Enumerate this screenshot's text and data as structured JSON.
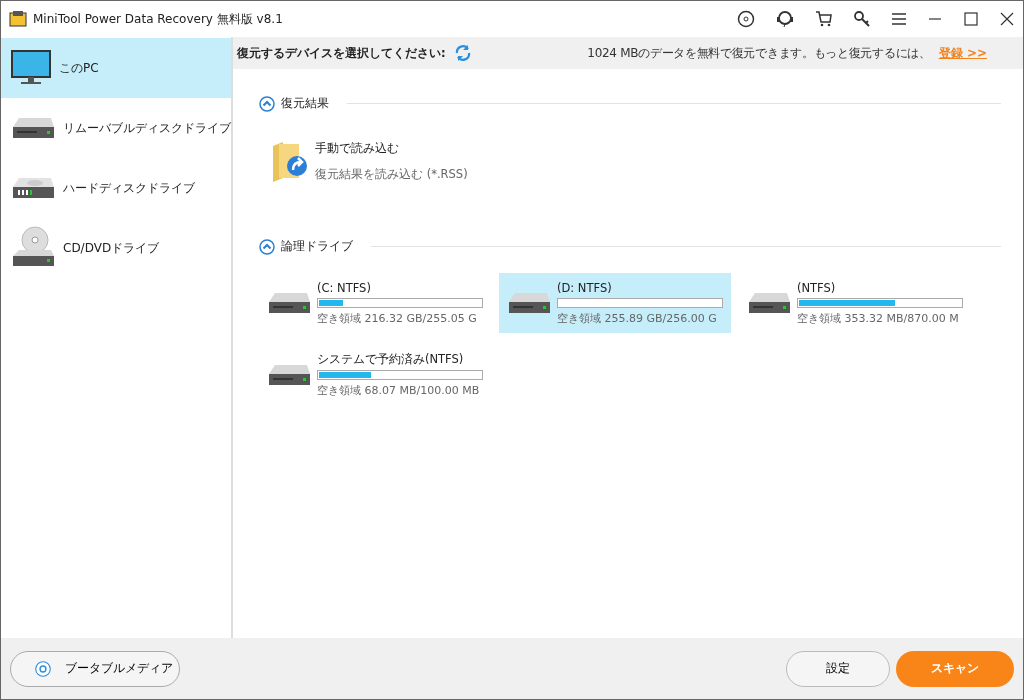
{
  "window": {
    "title": "MiniTool Power Data Recovery 無料版 v8.1"
  },
  "sidebar": {
    "items": [
      {
        "kind": "pc",
        "label": "このPC",
        "selected": true
      },
      {
        "kind": "removable",
        "label": "リムーバブルディスクドライブ",
        "selected": false
      },
      {
        "kind": "hdd",
        "label": "ハードディスクドライブ",
        "selected": false
      },
      {
        "kind": "cd",
        "label": "CD/DVDドライブ",
        "selected": false
      }
    ]
  },
  "header": {
    "prompt": "復元するデバイスを選択してください:",
    "notice": "1024 MBのデータを無料で復元できます。もっと復元するには、",
    "link": "登録 >>"
  },
  "sections": [
    {
      "title": "復元結果",
      "expanded": true,
      "load": {
        "title": "手動で読み込む",
        "subtitle": "復元結果を読み込む (*.RSS)"
      }
    },
    {
      "title": "論理ドライブ",
      "expanded": true,
      "drives": [
        {
          "name": "(C: NTFS)",
          "level": 0.15,
          "free": "空き領域 216.32 GB/255.05 G",
          "selected": false
        },
        {
          "name": "(D: NTFS)",
          "free": "空き領域 255.89 GB/256.00 G",
          "selected": true
        },
        {
          "name": "(NTFS)",
          "level": 0.59,
          "free": "空き領域 353.32 MB/870.00 M",
          "selected": false
        },
        {
          "name": "システムで予約済み(NTFS)",
          "level": 0.32,
          "free": "空き領域 68.07 MB/100.00 MB",
          "selected": false
        }
      ]
    }
  ],
  "footer": {
    "bootable": "ブータブルメディア",
    "settings": "設定",
    "scan": "スキャン"
  }
}
